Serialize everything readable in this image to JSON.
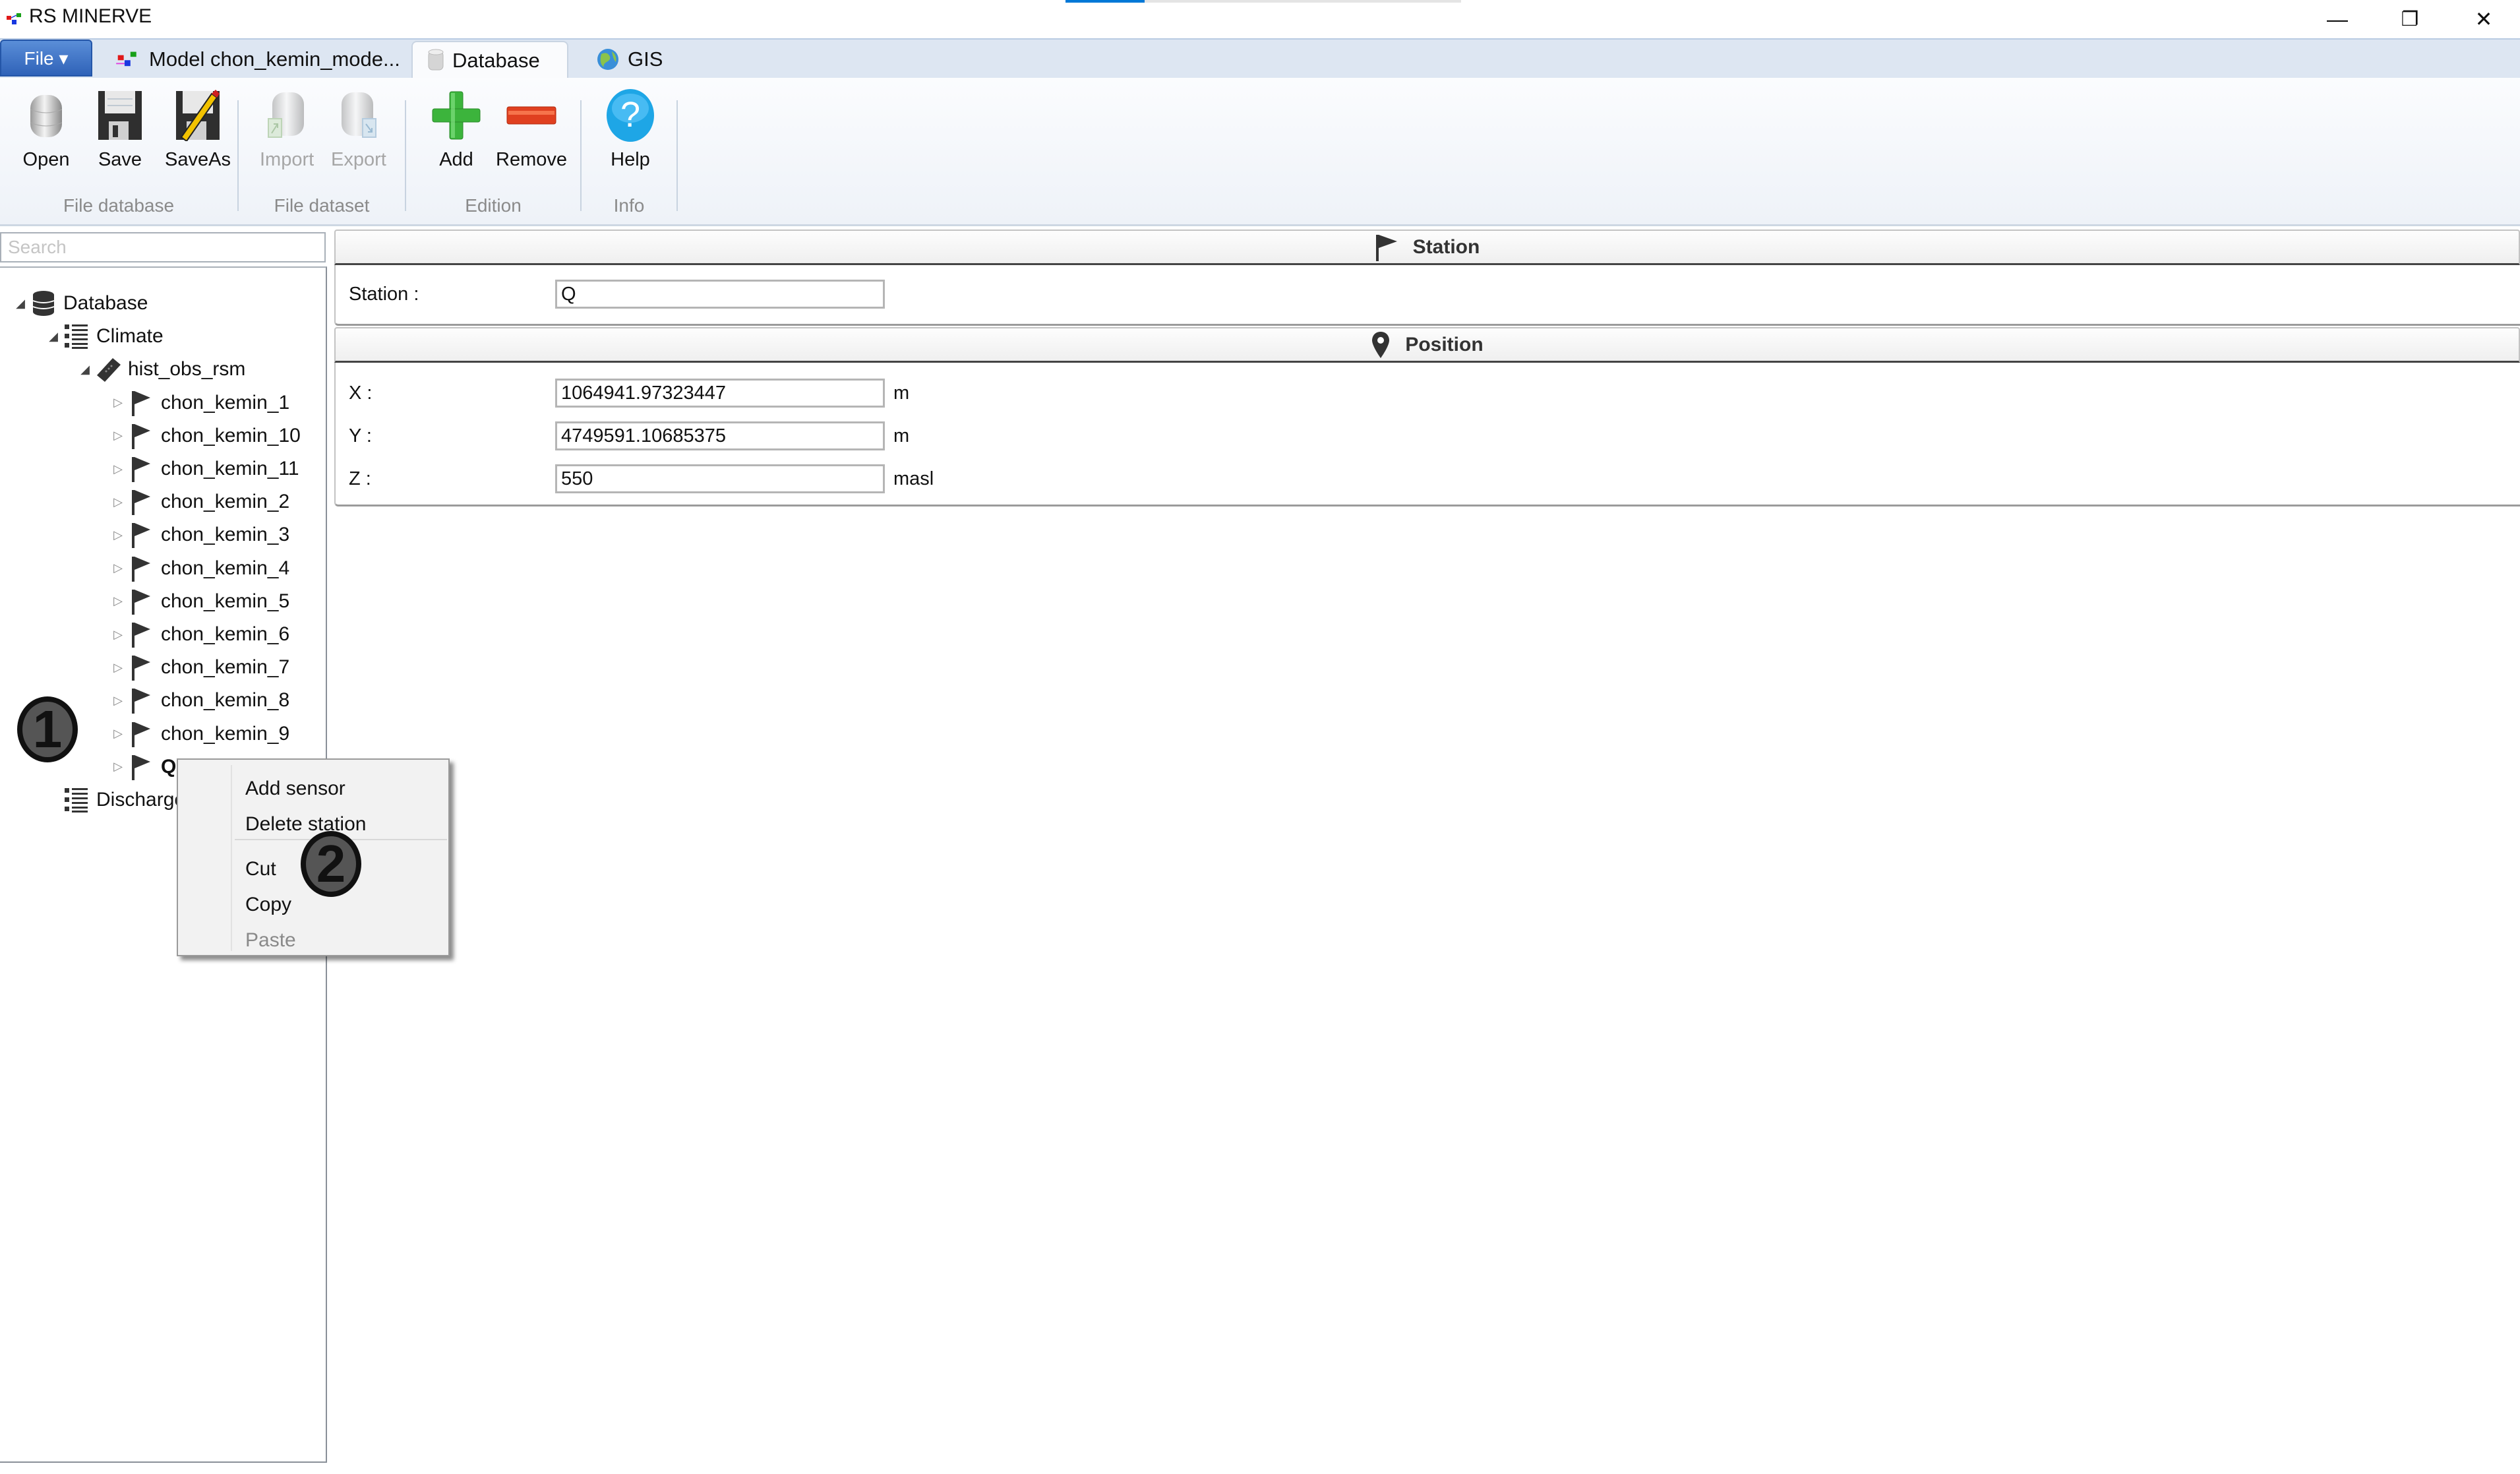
{
  "window": {
    "title": "RS MINERVE",
    "progress_percent": 20,
    "controls": {
      "minimize": "—",
      "restore": "❐",
      "close": "✕"
    }
  },
  "tabs": {
    "file_label": "File ▾",
    "items": [
      {
        "label": "Model chon_kemin_mode...",
        "icon": "model-icon",
        "active": false
      },
      {
        "label": "Database",
        "icon": "database-icon",
        "active": true
      },
      {
        "label": "GIS",
        "icon": "globe-icon",
        "active": false
      }
    ]
  },
  "ribbon": {
    "groups": [
      {
        "label": "File database",
        "buttons": [
          {
            "label": "Open",
            "icon": "database-open-icon",
            "enabled": true
          },
          {
            "label": "Save",
            "icon": "floppy-save-icon",
            "enabled": true
          },
          {
            "label": "SaveAs",
            "icon": "floppy-saveas-icon",
            "enabled": true
          }
        ]
      },
      {
        "label": "File dataset",
        "buttons": [
          {
            "label": "Import",
            "icon": "import-icon",
            "enabled": false
          },
          {
            "label": "Export",
            "icon": "export-icon",
            "enabled": false
          }
        ]
      },
      {
        "label": "Edition",
        "buttons": [
          {
            "label": "Add",
            "icon": "plus-icon",
            "enabled": true
          },
          {
            "label": "Remove",
            "icon": "minus-icon",
            "enabled": true
          }
        ]
      },
      {
        "label": "Info",
        "buttons": [
          {
            "label": "Help",
            "icon": "help-icon",
            "enabled": true
          }
        ]
      }
    ]
  },
  "tree": {
    "search_placeholder": "Search",
    "nodes": [
      {
        "label": "Database",
        "level": 0,
        "icon": "database-icon",
        "expander": "expanded"
      },
      {
        "label": "Climate",
        "level": 1,
        "icon": "list-icon",
        "expander": "expanded"
      },
      {
        "label": "hist_obs_rsm",
        "level": 2,
        "icon": "ticket-icon",
        "expander": "expanded"
      },
      {
        "label": "chon_kemin_1",
        "level": 3,
        "icon": "flag-icon",
        "expander": "collapsed"
      },
      {
        "label": "chon_kemin_10",
        "level": 3,
        "icon": "flag-icon",
        "expander": "collapsed"
      },
      {
        "label": "chon_kemin_11",
        "level": 3,
        "icon": "flag-icon",
        "expander": "collapsed"
      },
      {
        "label": "chon_kemin_2",
        "level": 3,
        "icon": "flag-icon",
        "expander": "collapsed"
      },
      {
        "label": "chon_kemin_3",
        "level": 3,
        "icon": "flag-icon",
        "expander": "collapsed"
      },
      {
        "label": "chon_kemin_4",
        "level": 3,
        "icon": "flag-icon",
        "expander": "collapsed"
      },
      {
        "label": "chon_kemin_5",
        "level": 3,
        "icon": "flag-icon",
        "expander": "collapsed"
      },
      {
        "label": "chon_kemin_6",
        "level": 3,
        "icon": "flag-icon",
        "expander": "collapsed"
      },
      {
        "label": "chon_kemin_7",
        "level": 3,
        "icon": "flag-icon",
        "expander": "collapsed"
      },
      {
        "label": "chon_kemin_8",
        "level": 3,
        "icon": "flag-icon",
        "expander": "collapsed"
      },
      {
        "label": "chon_kemin_9",
        "level": 3,
        "icon": "flag-icon",
        "expander": "collapsed"
      },
      {
        "label": "Q",
        "level": 3,
        "icon": "flag-icon",
        "expander": "collapsed",
        "selected": true
      },
      {
        "label": "Discharge",
        "level": 1,
        "icon": "list-icon",
        "expander": "none"
      }
    ]
  },
  "station_section": {
    "header": "Station",
    "fields": [
      {
        "label": "Station :",
        "value": "Q"
      }
    ]
  },
  "position_section": {
    "header": "Position",
    "fields": [
      {
        "label": "X :",
        "value": "1064941.97323447",
        "unit": "m"
      },
      {
        "label": "Y :",
        "value": "4749591.10685375",
        "unit": "m"
      },
      {
        "label": "Z :",
        "value": "550",
        "unit": "masl"
      }
    ]
  },
  "context_menu": {
    "items": [
      {
        "label": "Add sensor",
        "enabled": true
      },
      {
        "label": "Delete station",
        "enabled": true
      },
      {
        "label": "Cut",
        "enabled": true
      },
      {
        "label": "Copy",
        "enabled": true
      },
      {
        "label": "Paste",
        "enabled": false
      }
    ]
  },
  "callouts": [
    {
      "number": "1"
    },
    {
      "number": "2"
    }
  ],
  "colors": {
    "accent": "#0078d7",
    "file_button": "#2f62b8",
    "tabbar": "#dde6f2"
  }
}
